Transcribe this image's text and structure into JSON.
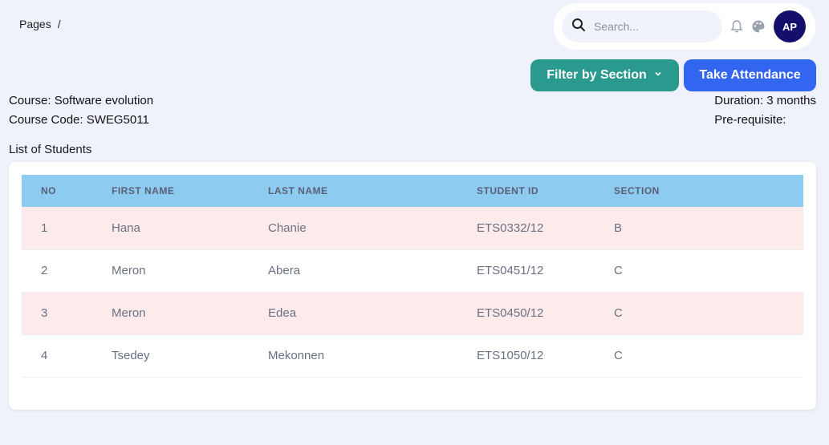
{
  "breadcrumb": {
    "root": "Pages",
    "separator": "/"
  },
  "topbar": {
    "search_placeholder": "Search...",
    "avatar_initials": "AP"
  },
  "actions": {
    "filter_label": "Filter by Section",
    "attendance_label": "Take Attendance"
  },
  "course": {
    "name_line": "Course: Software evolution",
    "code_line": "Course Code: SWEG5011",
    "duration_line": "Duration: 3 months",
    "prereq_line": "Pre-requisite:"
  },
  "list_title": "List of Students",
  "table": {
    "headers": [
      "NO",
      "FIRST NAME",
      "LAST NAME",
      "STUDENT ID",
      "SECTION"
    ],
    "rows": [
      [
        "1",
        "Hana",
        "Chanie",
        "ETS0332/12",
        "B"
      ],
      [
        "2",
        "Meron",
        "Abera",
        "ETS0451/12",
        "C"
      ],
      [
        "3",
        "Meron",
        "Edea",
        "ETS0450/12",
        "C"
      ],
      [
        "4",
        "Tsedey",
        "Mekonnen",
        "ETS1050/12",
        "C"
      ]
    ]
  },
  "colors": {
    "filter_button": "#2a9a8e",
    "attendance_button": "#3366f0",
    "header_row": "#8ecbf0",
    "odd_row": "#fdebeb",
    "avatar": "#140f6b"
  }
}
